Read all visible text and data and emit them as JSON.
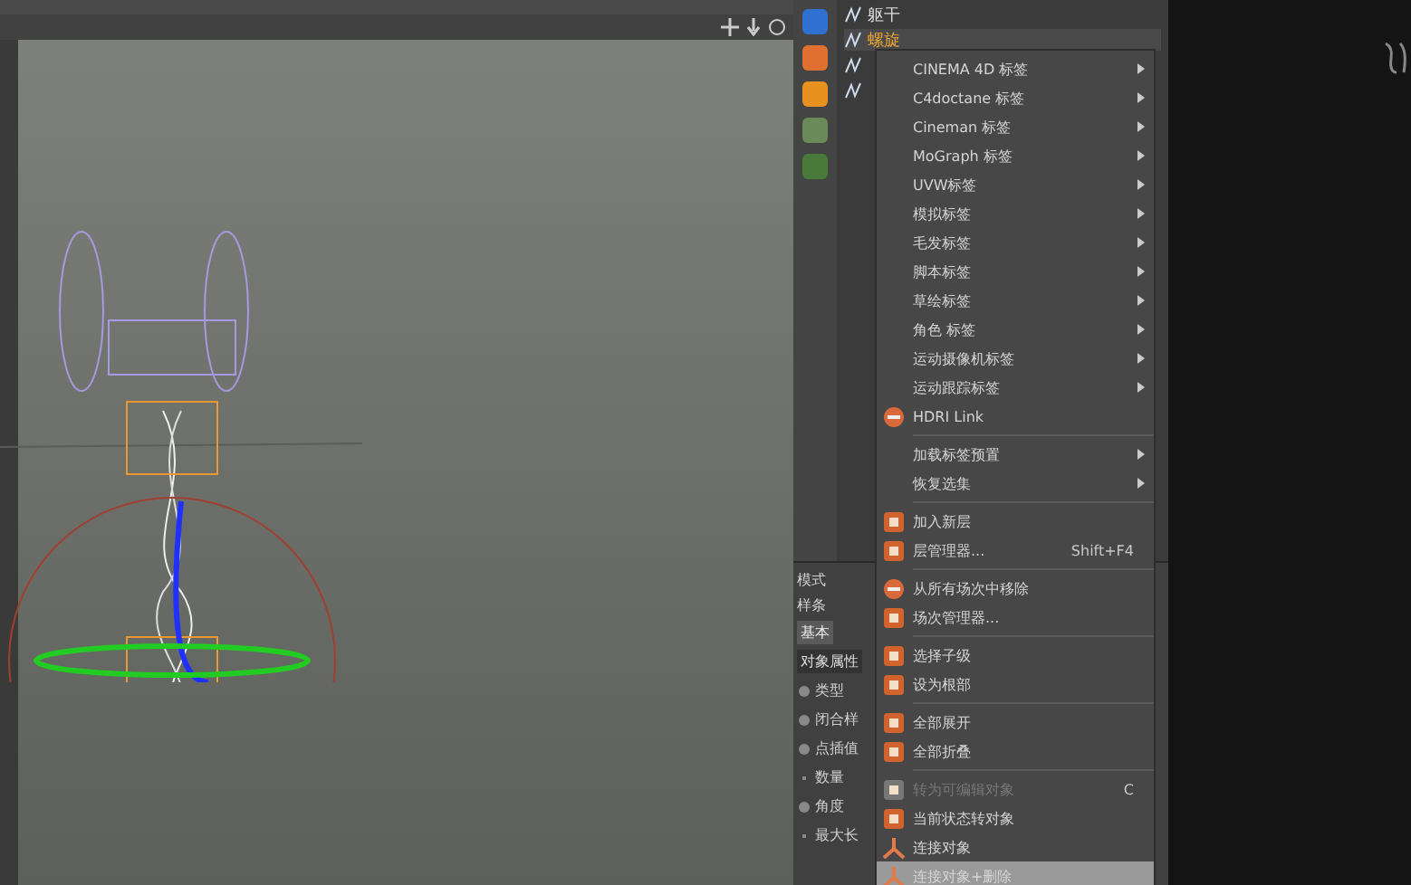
{
  "objects": [
    {
      "label": "躯干",
      "selected": false
    },
    {
      "label": "螺旋",
      "selected": true
    },
    {
      "selected": false
    },
    {
      "selected": false
    }
  ],
  "attributes": {
    "mode": "模式",
    "object": "样条",
    "tabs": [
      {
        "label": "基本"
      }
    ],
    "section": "对象属性",
    "fields": [
      {
        "label": "类型",
        "kind": "radio"
      },
      {
        "label": "闭合样",
        "kind": "radio"
      },
      {
        "label": "点插值",
        "kind": "radio"
      },
      {
        "label": "数量",
        "kind": "plain"
      },
      {
        "label": "角度",
        "kind": "radio"
      },
      {
        "label": "最大长",
        "kind": "plain"
      }
    ]
  },
  "menu": [
    {
      "kind": "item",
      "label": "CINEMA 4D 标签",
      "submenu": true
    },
    {
      "kind": "item",
      "label": "C4doctane 标签",
      "submenu": true
    },
    {
      "kind": "item",
      "label": "Cineman 标签",
      "submenu": true
    },
    {
      "kind": "item",
      "label": "MoGraph 标签",
      "submenu": true
    },
    {
      "kind": "item",
      "label": "UVW标签",
      "submenu": true
    },
    {
      "kind": "item",
      "label": "模拟标签",
      "submenu": true
    },
    {
      "kind": "item",
      "label": "毛发标签",
      "submenu": true
    },
    {
      "kind": "item",
      "label": "脚本标签",
      "submenu": true
    },
    {
      "kind": "item",
      "label": "草绘标签",
      "submenu": true
    },
    {
      "kind": "item",
      "label": "角色 标签",
      "submenu": true
    },
    {
      "kind": "item",
      "label": "运动摄像机标签",
      "submenu": true
    },
    {
      "kind": "item",
      "label": "运动跟踪标签",
      "submenu": true
    },
    {
      "kind": "item",
      "label": "HDRI Link"
    },
    {
      "kind": "separator"
    },
    {
      "kind": "item",
      "label": "加载标签预置",
      "submenu": true
    },
    {
      "kind": "item",
      "label": "恢复选集",
      "submenu": true
    },
    {
      "kind": "separator"
    },
    {
      "kind": "item",
      "label": "加入新层"
    },
    {
      "kind": "item",
      "label": "层管理器...",
      "shortcut": "Shift+F4"
    },
    {
      "kind": "separator"
    },
    {
      "kind": "item",
      "label": "从所有场次中移除"
    },
    {
      "kind": "item",
      "label": "场次管理器..."
    },
    {
      "kind": "separator"
    },
    {
      "kind": "item",
      "label": "选择子级"
    },
    {
      "kind": "item",
      "label": "设为根部"
    },
    {
      "kind": "separator"
    },
    {
      "kind": "item",
      "label": "全部展开"
    },
    {
      "kind": "item",
      "label": "全部折叠"
    },
    {
      "kind": "separator"
    },
    {
      "kind": "item",
      "label": "转为可编辑对象",
      "shortcut": "C",
      "disabled": true
    },
    {
      "kind": "item",
      "label": "当前状态转对象"
    },
    {
      "kind": "item",
      "label": "连接对象"
    },
    {
      "kind": "item",
      "label": "连接对象+删除",
      "selected": true
    }
  ]
}
